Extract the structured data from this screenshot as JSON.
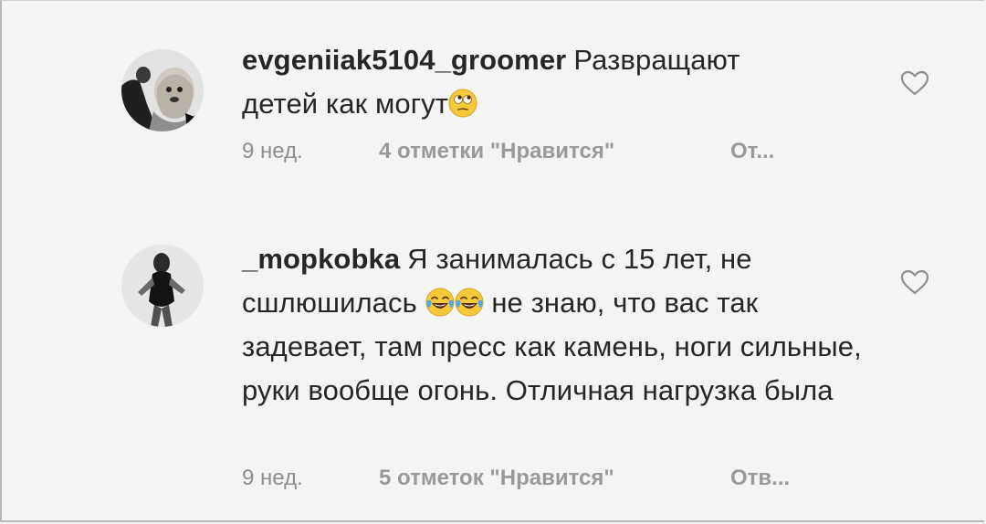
{
  "comments": [
    {
      "username": "evgeniiak5104_groomer",
      "text_line1": "Развращают",
      "text_line2": "детей как могут",
      "time": "9 нед.",
      "likes": "4 отметки \"Нравится\"",
      "reply": "От..."
    },
    {
      "username": "_mopkobka",
      "text_part1": "Я занималась с 15 лет, не сшлюшилась",
      "text_part2": "не знаю, что вас так задевает, там пресс как камень, ноги сильные, руки вообще огонь. Отличная нагрузка была",
      "time": "9 нед.",
      "likes": "5 отметок \"Нравится\"",
      "reply": "Отв..."
    }
  ],
  "icons": {
    "heart": "heart-outline-icon",
    "emoji_eyeroll": "face-with-rolling-eyes",
    "emoji_laugh": "face-with-tears-of-joy"
  }
}
